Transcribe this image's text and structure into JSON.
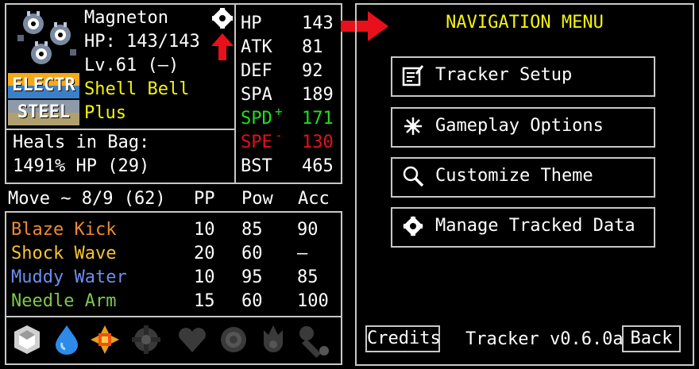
{
  "pokemon": {
    "name": "Magneton",
    "hp": "HP: 143/143",
    "level": "Lv.61 (—)",
    "item": "Shell Bell",
    "ability": "Plus",
    "types": [
      {
        "label": "ELECTR",
        "color": "#f7a81a"
      },
      {
        "label": "STEEL",
        "color": "#8f9aa8"
      }
    ],
    "heals_label": "Heals in Bag:",
    "heals_value": "1491% HP (29)"
  },
  "stats": [
    {
      "name": "HP",
      "value": "143",
      "mod": ""
    },
    {
      "name": "ATK",
      "value": "81",
      "mod": ""
    },
    {
      "name": "DEF",
      "value": "92",
      "mod": ""
    },
    {
      "name": "SPA",
      "value": "189",
      "mod": ""
    },
    {
      "name": "SPD",
      "value": "171",
      "mod": "+",
      "color": "#1ee01e"
    },
    {
      "name": "SPE",
      "value": "130",
      "mod": "-",
      "color": "#e8101a"
    },
    {
      "name": "BST",
      "value": "465",
      "mod": ""
    }
  ],
  "moves_header": {
    "title": "Move ~ 8/9 (62)",
    "pp": "PP",
    "pow": "Pow",
    "acc": "Acc"
  },
  "moves": [
    {
      "name": "Blaze Kick",
      "pp": "10",
      "pow": "85",
      "acc": "90",
      "color": "#f08a30"
    },
    {
      "name": "Shock Wave",
      "pp": "20",
      "pow": "60",
      "acc": "—",
      "color": "#f7c531"
    },
    {
      "name": "Muddy Water",
      "pp": "10",
      "pow": "95",
      "acc": "85",
      "color": "#6c8ef0"
    },
    {
      "name": "Needle Arm",
      "pp": "15",
      "pow": "60",
      "acc": "100",
      "color": "#7ec850"
    }
  ],
  "badges": [
    "stone-badge",
    "cascade-badge",
    "thunder-badge",
    "rainbow-badge",
    "soul-badge",
    "marsh-badge",
    "volcano-badge",
    "earth-badge"
  ],
  "nav": {
    "title": "NAVIGATION MENU",
    "buttons": [
      {
        "label": "Tracker Setup",
        "icon": "notepad-icon"
      },
      {
        "label": "Gameplay Options",
        "icon": "sparkle-icon"
      },
      {
        "label": "Customize Theme",
        "icon": "magnifier-icon"
      },
      {
        "label": "Manage Tracked Data",
        "icon": "gear-icon"
      }
    ],
    "credits": "Credits",
    "version": "Tracker v0.6.0a",
    "back": "Back"
  },
  "colors": {
    "border": "#c8c8c8",
    "title": "#f4f40c",
    "arrow": "#e8101a"
  }
}
